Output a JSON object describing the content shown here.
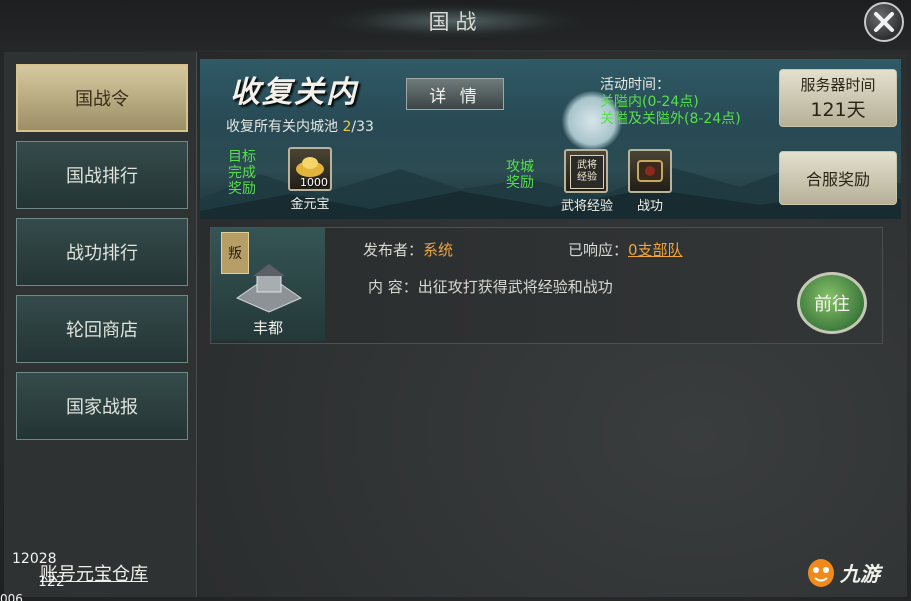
{
  "window": {
    "title": "国战"
  },
  "sidebar": {
    "items": [
      {
        "label": "国战令"
      },
      {
        "label": "国战排行"
      },
      {
        "label": "战功排行"
      },
      {
        "label": "轮回商店"
      },
      {
        "label": "国家战报"
      }
    ],
    "warehouse_label": "账号元宝仓库"
  },
  "banner": {
    "title": "收复关内",
    "subtitle_prefix": "收复所有关内城池 ",
    "progress_current": "2",
    "progress_total": "/33",
    "detail_label": "详 情",
    "activity_time_label": "活动时间：",
    "activity_time_1": "关隘内(0-24点)",
    "activity_time_2": "关隘及关隘外(8-24点)",
    "goal_reward_label": "目标\n完成\n奖励",
    "goal_reward_item": {
      "caption": "金元宝",
      "qty": "1000"
    },
    "siege_reward_label": "攻城\n奖励",
    "siege_reward_items": [
      {
        "caption": "武将经验",
        "icon_text": "武将\n经验"
      },
      {
        "caption": "战功"
      }
    ],
    "server_time_label": "服务器时间",
    "server_time_value": "121天",
    "merge_reward_label": "合服奖励"
  },
  "task": {
    "city_name": "丰都",
    "flag_text": "叛",
    "publisher_label": "发布者：",
    "publisher_value": "系统",
    "responded_label": "已响应：",
    "responded_value": "0支部队",
    "content_label": "内  容：",
    "content_value": "出征攻打获得武将经验和战功",
    "go_label": "前往"
  },
  "overlay": {
    "debug_1": "12028",
    "debug_2": "122",
    "debug_3": "006",
    "logo_text": "九游"
  }
}
